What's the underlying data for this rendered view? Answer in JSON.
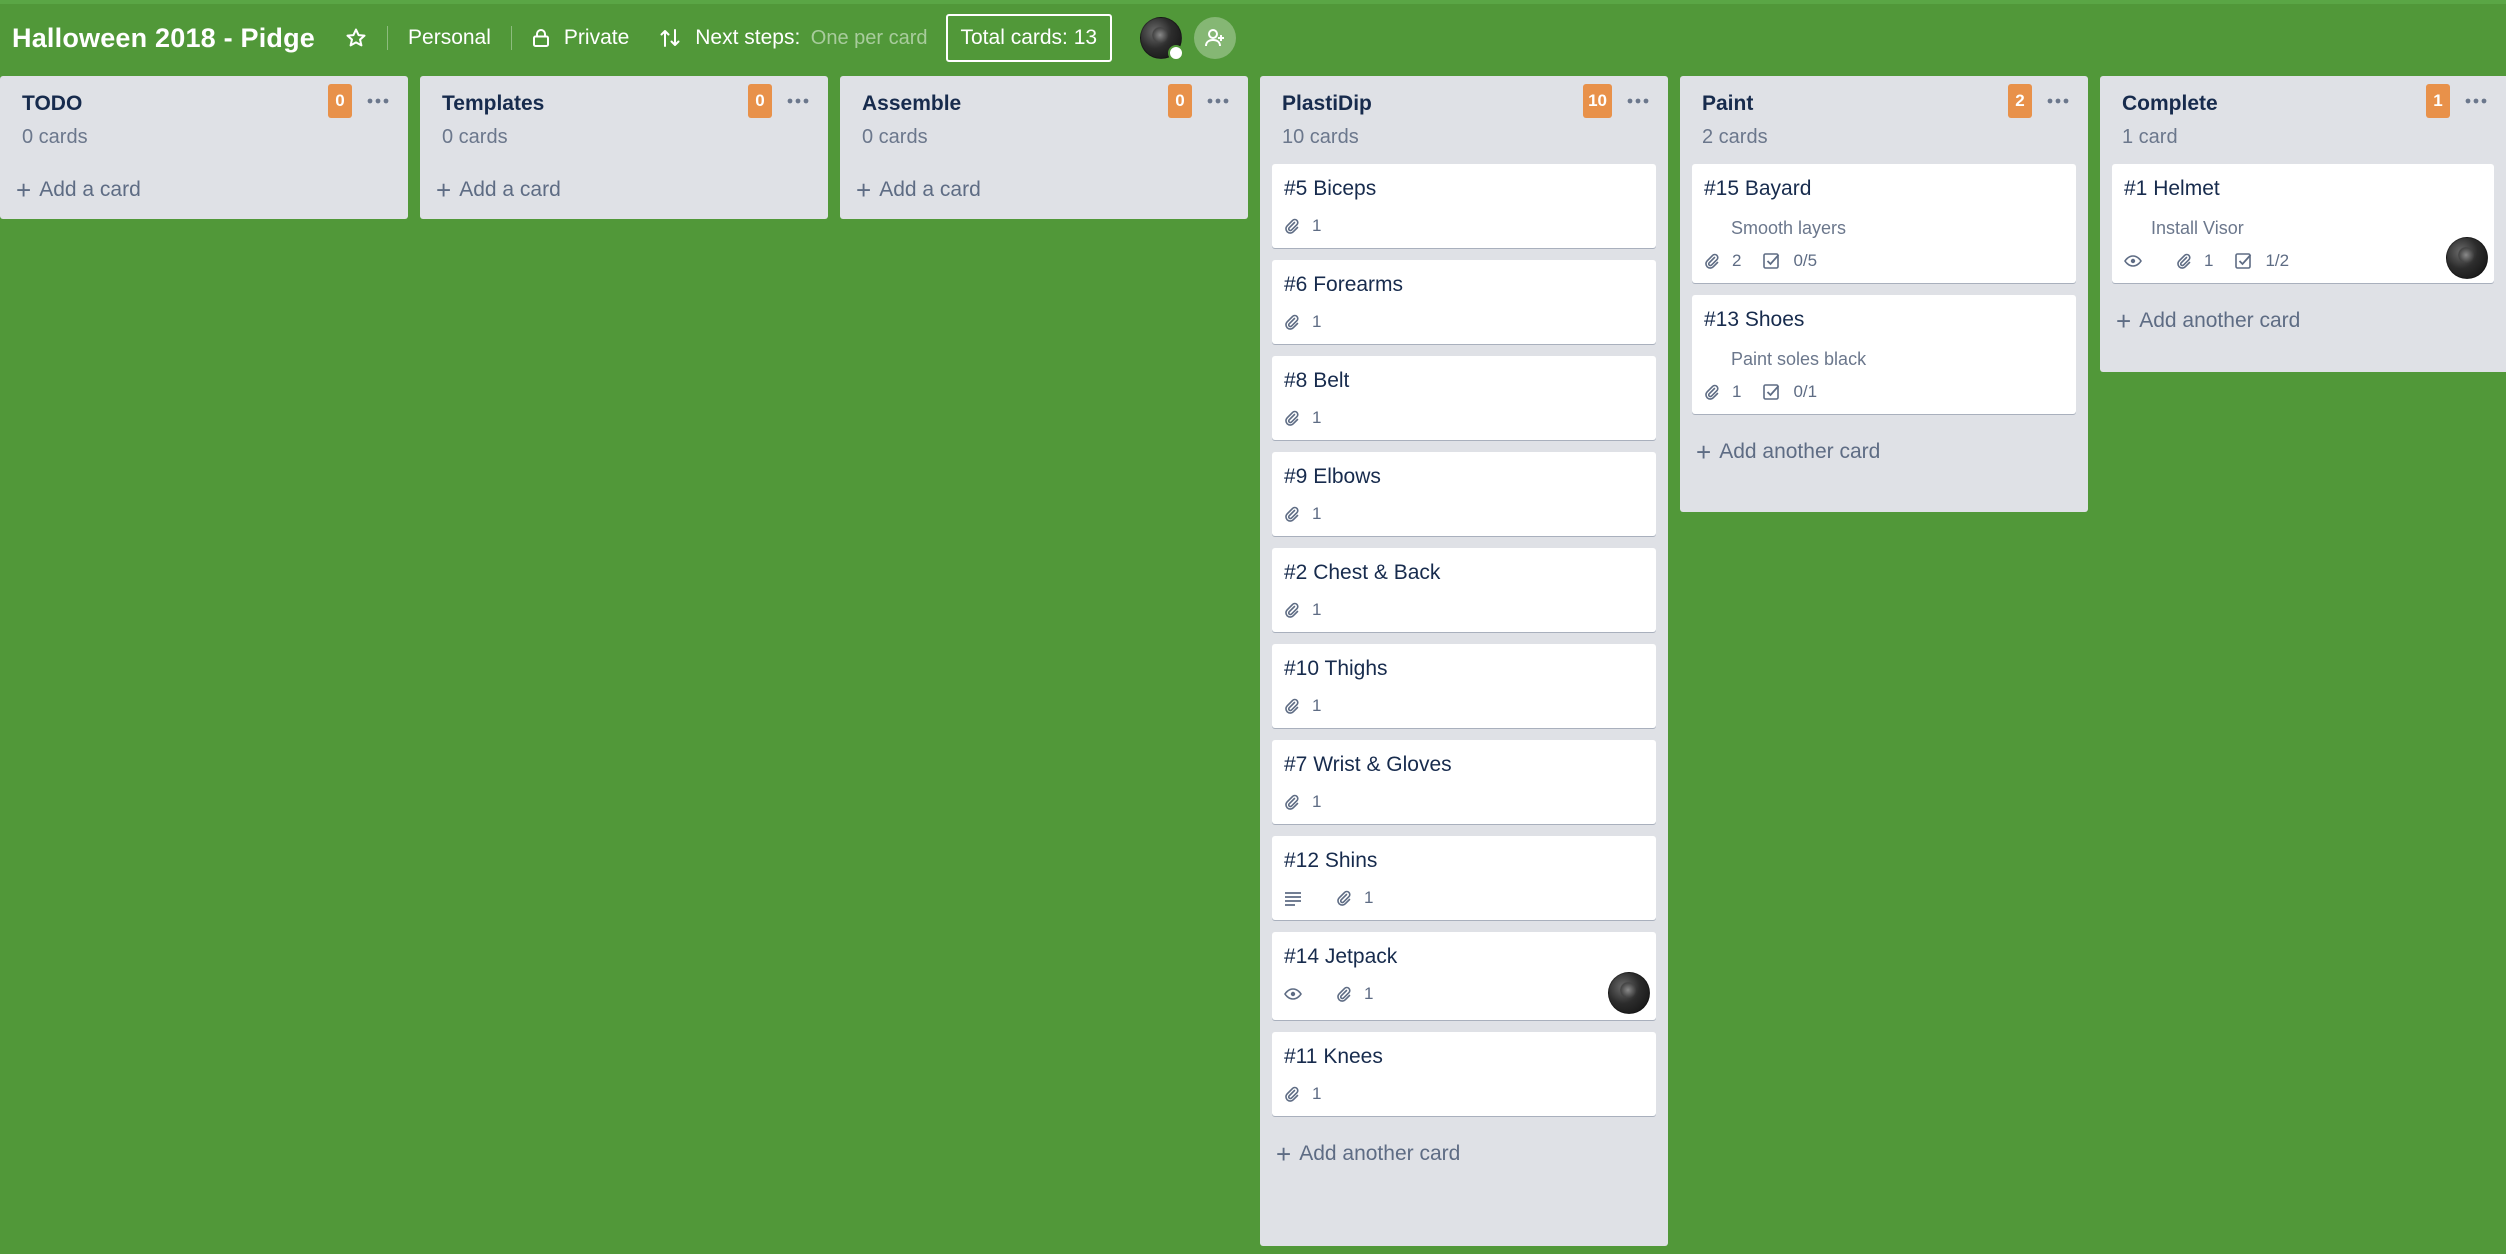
{
  "board": {
    "title": "Halloween 2018 - Pidge",
    "team_label": "Personal",
    "visibility_label": "Private",
    "next_steps_label": "Next steps:",
    "next_steps_value": "One per card",
    "total_cards": "Total cards: 13"
  },
  "lists": [
    {
      "name": "TODO",
      "count": "0 cards",
      "badge": "0",
      "add_label": "Add a card"
    },
    {
      "name": "Templates",
      "count": "0 cards",
      "badge": "0",
      "add_label": "Add a card"
    },
    {
      "name": "Assemble",
      "count": "0 cards",
      "badge": "0",
      "add_label": "Add a card"
    },
    {
      "name": "PlastiDip",
      "count": "10 cards",
      "badge": "10",
      "add_label": "Add another card",
      "cards": [
        {
          "title": "#5 Biceps",
          "attachments": "1"
        },
        {
          "title": "#6 Forearms",
          "attachments": "1"
        },
        {
          "title": "#8 Belt",
          "attachments": "1"
        },
        {
          "title": "#9 Elbows",
          "attachments": "1"
        },
        {
          "title": "#2 Chest & Back",
          "attachments": "1"
        },
        {
          "title": "#10 Thighs",
          "attachments": "1"
        },
        {
          "title": "#7 Wrist & Gloves",
          "attachments": "1"
        },
        {
          "title": "#12 Shins",
          "attachments": "1"
        },
        {
          "title": "#14 Jetpack",
          "attachments": "1"
        },
        {
          "title": "#11 Knees",
          "attachments": "1"
        }
      ]
    },
    {
      "name": "Paint",
      "count": "2 cards",
      "badge": "2",
      "add_label": "Add another card",
      "cards": [
        {
          "title": "#15 Bayard",
          "description": "Smooth layers",
          "attachments": "2",
          "checklist": "0/5"
        },
        {
          "title": "#13 Shoes",
          "description": "Paint soles black",
          "attachments": "1",
          "checklist": "0/1"
        }
      ]
    },
    {
      "name": "Complete",
      "count": "1 card",
      "badge": "1",
      "add_label": "Add another card",
      "cards": [
        {
          "title": "#1 Helmet",
          "description": "Install Visor",
          "attachments": "1",
          "checklist": "1/2"
        }
      ]
    }
  ],
  "icons": [
    "star-icon",
    "lock-icon",
    "sort-icon",
    "ellipsis-icon",
    "paperclip-icon",
    "checklist-icon",
    "eye-icon",
    "description-icon",
    "add-member-icon",
    "plus-icon"
  ],
  "colors": {
    "board_bg": "#519839",
    "list_bg": "#dfe1e6",
    "badge_orange": "#e8914a",
    "text_dark": "#172b4d",
    "text_muted": "#5e6c84"
  }
}
